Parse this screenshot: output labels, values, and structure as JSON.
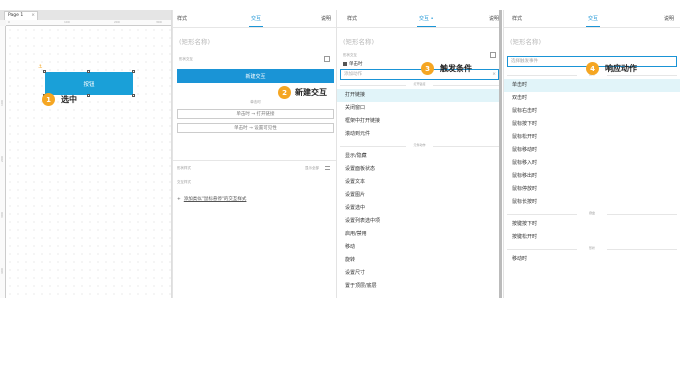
{
  "canvas": {
    "page_tab": "Page 1",
    "tab_close": "×",
    "ruler_top": [
      "0",
      "100",
      "200",
      "300"
    ],
    "ruler_left": [
      "100",
      "200",
      "300",
      "400",
      "500"
    ],
    "widget_label": "按钮",
    "anchor_glyph": "⚓"
  },
  "steps": [
    {
      "num": "1",
      "label": "选中"
    },
    {
      "num": "2",
      "label": "新建交互"
    },
    {
      "num": "3",
      "label": "触发条件"
    },
    {
      "num": "4",
      "label": "响应动作"
    }
  ],
  "panel2": {
    "tabs": [
      "样式",
      "交互",
      "说明"
    ],
    "shape_name": "(矩形名称)",
    "section": "形状交互",
    "new_interaction": "新建交互",
    "sub_label": "单击时",
    "ghost1": "单击时 → 打开链接",
    "ghost2": "单击时 → 设置可见性",
    "style_label": "形状样式",
    "show_all": "显示全部",
    "interaction_style": "交互样式",
    "add_style_plus": "+",
    "add_style": "添加类似\"鼠标悬停\"的交互样式"
  },
  "panel3": {
    "tabs": [
      "样式",
      "交互 •",
      "说明"
    ],
    "shape_name": "(矩形名称)",
    "section": "形状交互",
    "tree_row": "单击时",
    "search_placeholder": "添加动作",
    "search_clear": "×",
    "group_link": "打开链接",
    "link_items": [
      "打开链接",
      "关闭窗口",
      "框架中打开链接",
      "滚动到元件"
    ],
    "group_widget": "元件动作",
    "widget_items": [
      "显示/隐藏",
      "设置面板状态",
      "设置文本",
      "设置图片",
      "设置选中",
      "设置列表选中项",
      "启用/禁用",
      "移动",
      "旋转",
      "设置尺寸",
      "置于顶层/底层"
    ]
  },
  "panel4": {
    "tabs": [
      "样式",
      "交互",
      "说明"
    ],
    "shape_name": "(矩形名称)",
    "search_placeholder": "选择触发事件",
    "group_mouse": "鼠标",
    "mouse_items": [
      "单击时",
      "双击时",
      "鼠标右击时",
      "鼠标按下时",
      "鼠标松开时",
      "鼠标移动时",
      "鼠标移入时",
      "鼠标移出时",
      "鼠标停放时",
      "鼠标长按时"
    ],
    "group_key": "键盘",
    "key_items": [
      "按键按下时",
      "按键松开时"
    ],
    "group_shape": "形状",
    "shape_items": [
      "移动时"
    ]
  },
  "colors": {
    "accent": "#1a94d6",
    "widget": "#1aa0d8",
    "step": "#f5a623",
    "highlight": "#e1f4f9"
  }
}
